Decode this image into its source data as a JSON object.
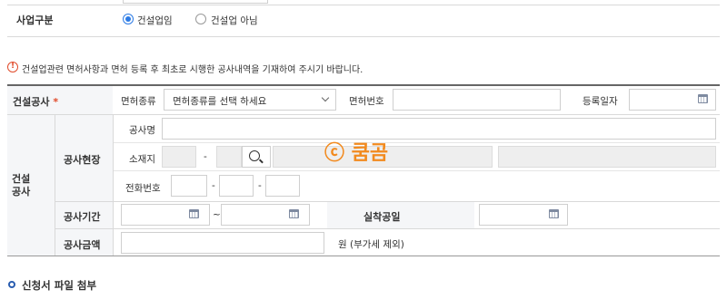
{
  "top_row": {
    "label": "사업구분",
    "options": [
      {
        "label": "건설업임",
        "selected": true
      },
      {
        "label": "건설업 아님",
        "selected": false
      }
    ]
  },
  "notice": "건설업관련 면허사항과 면허 등록 후 최초로 시행한 공사내역을 기재하여 주시기 바랍니다.",
  "construction_company": {
    "label": "건설공사",
    "required_mark": "*",
    "license_type_label": "면허종류",
    "license_type_placeholder": "면허종류를 선택 하세요",
    "license_number_label": "면허번호",
    "registration_date_label": "등록일자"
  },
  "construction": {
    "section_label_line1": "건설",
    "section_label_line2": "공사",
    "site_label": "공사현장",
    "name_label": "공사명",
    "location_label": "소재지",
    "phone_label": "전화번호",
    "dash": "-",
    "tilde": "~",
    "period_label": "공사기간",
    "actual_start_label": "실착공일",
    "amount_label": "공사금액",
    "amount_unit": "원 (부가세 제외)"
  },
  "watermark": "ⓒ 쿰곰",
  "attachment_title": "신청서 파일 첨부",
  "colors": {
    "accent": "#2c7be5",
    "warning": "#e14c2c",
    "watermark": "#f28a1e"
  }
}
